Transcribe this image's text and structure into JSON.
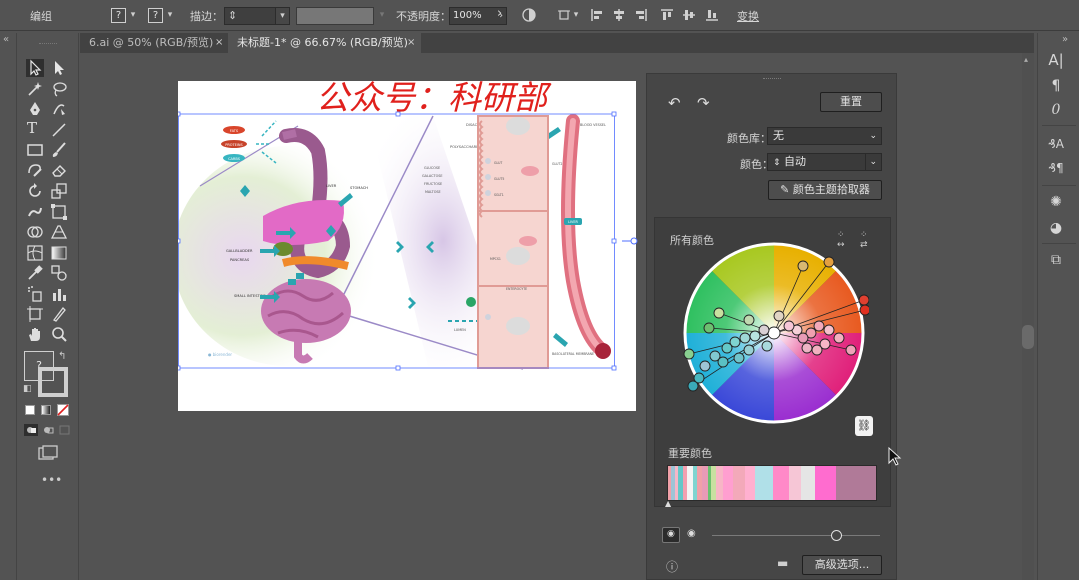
{
  "control_bar": {
    "mode": "编组",
    "stroke_label": "描边：",
    "opacity_label": "不透明度：",
    "opacity_value": "100%",
    "transform_label": "变换",
    "question_mark": "?"
  },
  "tabs": [
    {
      "label": "6.ai @ 50% (RGB/预览)",
      "active": false,
      "close": "×"
    },
    {
      "label": "未标题-1* @ 66.67% (RGB/预览)",
      "active": true,
      "close": "×"
    }
  ],
  "artwork": {
    "watermark": "公众号：科研部",
    "labels": {
      "fats": "FATS",
      "proteins": "PROTEINS",
      "carbs": "CARBS",
      "liver": "LIVER",
      "stomach": "STOMACH",
      "gallbladder": "GALLBLADDER",
      "pancreas": "PANCREAS",
      "small_intestine": "SMALL INTESTINE",
      "disaccharides": "DISACCHARIDE",
      "polysaccharides": "POLYSACCHARIDE",
      "glucose": "GLUCOSE",
      "galactose": "GALACTOSE",
      "fructose": "FRUCTOSE",
      "maltose": "MALTOSE",
      "glut": "GLUT",
      "glut5": "GLUT5",
      "sglt1": "SGLT1",
      "glut2": "GLUT2",
      "mpcs1": "MPCS1",
      "enterocyte": "ENTEROCYTE",
      "lumen": "LUMEN",
      "basolateral": "BASOLATERAL MEMBRANE",
      "blood_vessel": "BLOOD VESSEL",
      "liver_tag": "LIVER",
      "credit": "● biorender"
    }
  },
  "color_guide": {
    "reset_button": "重置",
    "library_label": "颜色库：",
    "library_value": "无",
    "color_label": "颜色：",
    "color_value": "自动",
    "picker_button": "颜色主题拾取器",
    "all_colors_label": "所有颜色",
    "key_colors_label": "重要颜色",
    "advanced_button": "高级选项...",
    "link_icon_char": "⛓",
    "strip_colors": [
      "#f0a0a8",
      "#9ec4d6",
      "#f5b7c8",
      "#64c8c8",
      "#f3a0b0",
      "#f5f5f5",
      "#7fd4d0",
      "#f0a0a8",
      "#e89bb6",
      "#6cc070",
      "#c8e0a0",
      "#f7b6c6",
      "#ff9fd0",
      "#f3a9ba",
      "#ffb0d0",
      "#b0e0e8",
      "#ff89c8",
      "#f6c6d6",
      "#e5e5e5",
      "#ff6ccf",
      "#b07a98"
    ]
  },
  "left_strip_icon": "«",
  "right_strip_icon": "»"
}
